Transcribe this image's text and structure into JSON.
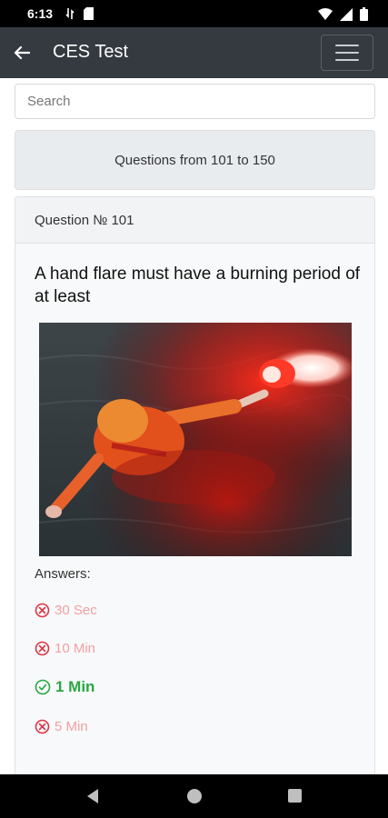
{
  "status_bar": {
    "time": "6:13",
    "left_icons": [
      "data-transfer-icon",
      "sd-card-icon"
    ],
    "right_icons": [
      "wifi-icon",
      "signal-icon",
      "battery-icon"
    ]
  },
  "app_bar": {
    "title": "CES Test",
    "back_icon": "arrow-left-icon",
    "menu_icon": "hamburger-menu-icon",
    "background": "#343a40"
  },
  "search": {
    "placeholder": "Search",
    "value": ""
  },
  "range_button": {
    "label": "Questions from 101 to 150"
  },
  "question": {
    "header": "Question № 101",
    "text": "A hand flare must have a burning period of at least",
    "answers_label": "Answers:",
    "answers": [
      {
        "label": "30 Sec",
        "correct": false,
        "icon": "x-circle-icon"
      },
      {
        "label": "10 Min",
        "correct": false,
        "icon": "x-circle-icon"
      },
      {
        "label": "1 Min",
        "correct": true,
        "icon": "check-circle-icon"
      },
      {
        "label": "5 Min",
        "correct": false,
        "icon": "x-circle-icon"
      }
    ]
  },
  "colors": {
    "correct": "#28a745",
    "incorrect": "#dc3545"
  },
  "nav_bar": {
    "icons": [
      "back-triangle-icon",
      "home-circle-icon",
      "recents-square-icon"
    ]
  }
}
